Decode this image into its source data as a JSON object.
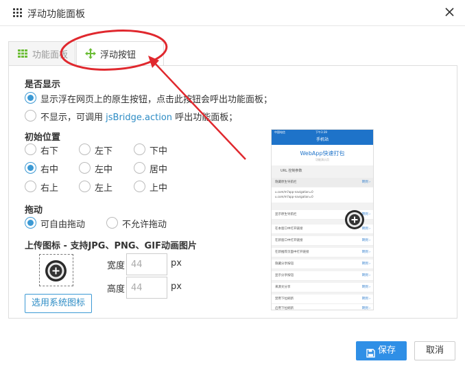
{
  "dialog": {
    "title": "浮动功能面板"
  },
  "tabs": [
    {
      "label": "功能面板",
      "active": false
    },
    {
      "label": "浮动按钮",
      "active": true
    }
  ],
  "display": {
    "heading": "是否显示",
    "options": [
      {
        "text": "显示浮在网页上的原生按钮，点击此按钮会呼出功能面板；",
        "selected": true
      },
      {
        "text_prefix": "不显示，可调用 ",
        "text_link": "jsBridge.action",
        "text_suffix": " 呼出功能面板；",
        "selected": false
      }
    ]
  },
  "position": {
    "heading": "初始位置",
    "options": [
      {
        "label": "右下",
        "selected": false
      },
      {
        "label": "左下",
        "selected": false
      },
      {
        "label": "下中",
        "selected": false
      },
      {
        "label": "右中",
        "selected": true
      },
      {
        "label": "左中",
        "selected": false
      },
      {
        "label": "居中",
        "selected": false
      },
      {
        "label": "右上",
        "selected": false
      },
      {
        "label": "左上",
        "selected": false
      },
      {
        "label": "上中",
        "selected": false
      }
    ]
  },
  "drag": {
    "heading": "拖动",
    "options": [
      {
        "label": "可自由拖动",
        "selected": true
      },
      {
        "label": "不允许拖动",
        "selected": false
      }
    ]
  },
  "upload": {
    "heading": "上传图标 - 支持JPG、PNG、GIF动画图片",
    "width_label": "宽度",
    "width_value": "44",
    "height_label": "高度",
    "height_value": "44",
    "unit": "px",
    "system_icon_button": "选用系统图标"
  },
  "preview": {
    "status_left": "中国电信",
    "status_time": "下午3:39",
    "nav_title": "手机站",
    "hero_title": "WebApp快速打包",
    "hero_sub": "功能演示页",
    "section": "URL 控制参数",
    "rows": [
      {
        "label": "隐藏原生导航栏",
        "action": "转到 ›"
      },
      {
        "label": "显示原生导航栏",
        "action": "转到 ›"
      },
      {
        "label": "在本窗口中打开链接",
        "action": "转到 ›"
      },
      {
        "label": "在新窗口中打开链接",
        "action": "转到 ›"
      },
      {
        "label": "在新推荐页面中打开链接",
        "action": "转到 ›"
      },
      {
        "label": "隐藏分享按钮",
        "action": "转到 ›"
      },
      {
        "label": "显示分享按钮",
        "action": "转到 ›"
      },
      {
        "label": "来源文分享",
        "action": "转到 ›"
      },
      {
        "label": "禁用下拉刷新",
        "action": "转到 ›"
      },
      {
        "label": "启用下拉刷新",
        "action": "转到 ›"
      }
    ],
    "code_lines": [
      "u.com/m?app-navigation=0",
      "u.com/m?app-navigation=0"
    ]
  },
  "footer": {
    "save": "保存",
    "cancel": "取消"
  },
  "colors": {
    "accent": "#3b99d4",
    "primary_button": "#2f8fe6",
    "annotation": "#e0282e",
    "tab_icon": "#6bbd35"
  }
}
